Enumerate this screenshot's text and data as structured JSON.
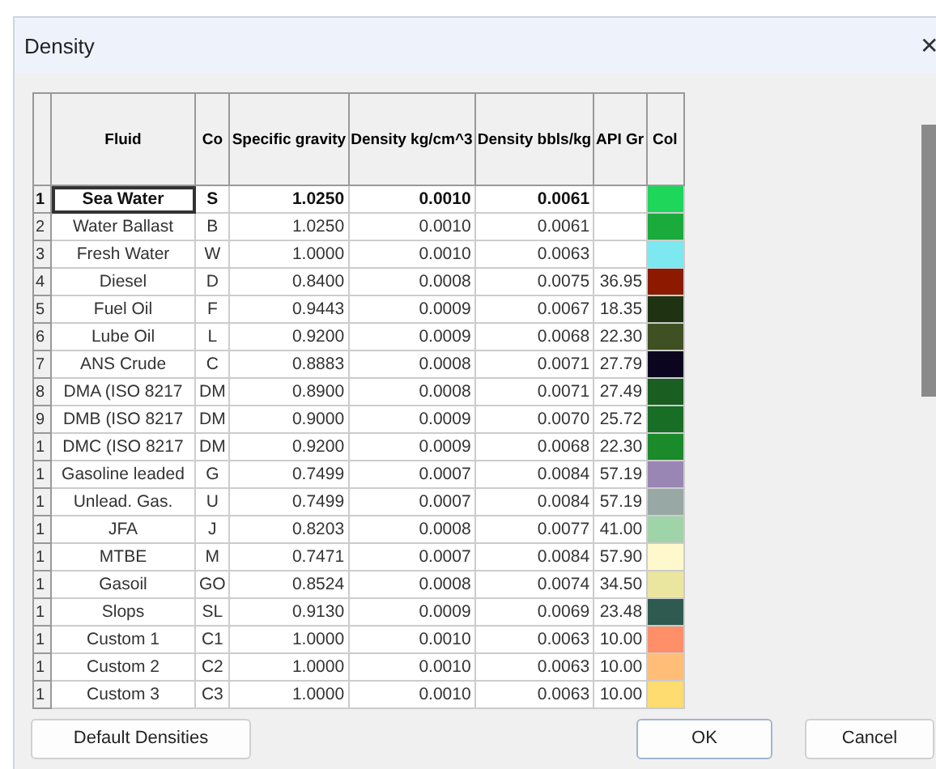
{
  "window": {
    "title": "Density",
    "close": "✕"
  },
  "table": {
    "columns": [
      "Fluid",
      "Co",
      "Specific gravity",
      "Density kg/cm^3",
      "Density bbls/kg",
      "API Gr",
      "Col"
    ],
    "rows": [
      {
        "index": "1",
        "fluid": "Sea Water",
        "code": "S",
        "sg": "1.0250",
        "kg": "0.0010",
        "bbl": "0.0061",
        "api": "",
        "color": "#1ed65a",
        "selected": true
      },
      {
        "index": "2",
        "fluid": "Water Ballast",
        "code": "B",
        "sg": "1.0250",
        "kg": "0.0010",
        "bbl": "0.0061",
        "api": "",
        "color": "#1aab3c",
        "selected": false
      },
      {
        "index": "3",
        "fluid": "Fresh Water",
        "code": "W",
        "sg": "1.0000",
        "kg": "0.0010",
        "bbl": "0.0063",
        "api": "",
        "color": "#7de8f0",
        "selected": false
      },
      {
        "index": "4",
        "fluid": "Diesel",
        "code": "D",
        "sg": "0.8400",
        "kg": "0.0008",
        "bbl": "0.0075",
        "api": "36.95",
        "color": "#8b1a00",
        "selected": false
      },
      {
        "index": "5",
        "fluid": "Fuel Oil",
        "code": "F",
        "sg": "0.9443",
        "kg": "0.0009",
        "bbl": "0.0067",
        "api": "18.35",
        "color": "#1f3312",
        "selected": false
      },
      {
        "index": "6",
        "fluid": "Lube Oil",
        "code": "L",
        "sg": "0.9200",
        "kg": "0.0009",
        "bbl": "0.0068",
        "api": "22.30",
        "color": "#3f5022",
        "selected": false
      },
      {
        "index": "7",
        "fluid": "ANS Crude",
        "code": "C",
        "sg": "0.8883",
        "kg": "0.0008",
        "bbl": "0.0071",
        "api": "27.79",
        "color": "#0c0520",
        "selected": false
      },
      {
        "index": "8",
        "fluid": "DMA (ISO 8217",
        "code": "DM",
        "sg": "0.8900",
        "kg": "0.0008",
        "bbl": "0.0071",
        "api": "27.49",
        "color": "#1a5e22",
        "selected": false
      },
      {
        "index": "9",
        "fluid": "DMB (ISO 8217",
        "code": "DM",
        "sg": "0.9000",
        "kg": "0.0009",
        "bbl": "0.0070",
        "api": "25.72",
        "color": "#186e24",
        "selected": false
      },
      {
        "index": "1",
        "fluid": "DMC (ISO 8217",
        "code": "DM",
        "sg": "0.9200",
        "kg": "0.0009",
        "bbl": "0.0068",
        "api": "22.30",
        "color": "#1a8a2a",
        "selected": false
      },
      {
        "index": "1",
        "fluid": "Gasoline leaded",
        "code": "G",
        "sg": "0.7499",
        "kg": "0.0007",
        "bbl": "0.0084",
        "api": "57.19",
        "color": "#9a86b4",
        "selected": false
      },
      {
        "index": "1",
        "fluid": "Unlead. Gas.",
        "code": "U",
        "sg": "0.7499",
        "kg": "0.0007",
        "bbl": "0.0084",
        "api": "57.19",
        "color": "#98a8a4",
        "selected": false
      },
      {
        "index": "1",
        "fluid": "JFA",
        "code": "J",
        "sg": "0.8203",
        "kg": "0.0008",
        "bbl": "0.0077",
        "api": "41.00",
        "color": "#9fd4a8",
        "selected": false
      },
      {
        "index": "1",
        "fluid": "MTBE",
        "code": "M",
        "sg": "0.7471",
        "kg": "0.0007",
        "bbl": "0.0084",
        "api": "57.90",
        "color": "#fff8cc",
        "selected": false
      },
      {
        "index": "1",
        "fluid": "Gasoil",
        "code": "GO",
        "sg": "0.8524",
        "kg": "0.0008",
        "bbl": "0.0074",
        "api": "34.50",
        "color": "#eae6a0",
        "selected": false
      },
      {
        "index": "1",
        "fluid": "Slops",
        "code": "SL",
        "sg": "0.9130",
        "kg": "0.0009",
        "bbl": "0.0069",
        "api": "23.48",
        "color": "#2e5a50",
        "selected": false
      },
      {
        "index": "1",
        "fluid": "Custom 1",
        "code": "C1",
        "sg": "1.0000",
        "kg": "0.0010",
        "bbl": "0.0063",
        "api": "10.00",
        "color": "#ff8f68",
        "selected": false
      },
      {
        "index": "1",
        "fluid": "Custom 2",
        "code": "C2",
        "sg": "1.0000",
        "kg": "0.0010",
        "bbl": "0.0063",
        "api": "10.00",
        "color": "#ffbd78",
        "selected": false
      },
      {
        "index": "1",
        "fluid": "Custom 3",
        "code": "C3",
        "sg": "1.0000",
        "kg": "0.0010",
        "bbl": "0.0063",
        "api": "10.00",
        "color": "#ffdc70",
        "selected": false
      }
    ]
  },
  "buttons": [
    "Default Densities",
    "OK",
    "Cancel"
  ]
}
